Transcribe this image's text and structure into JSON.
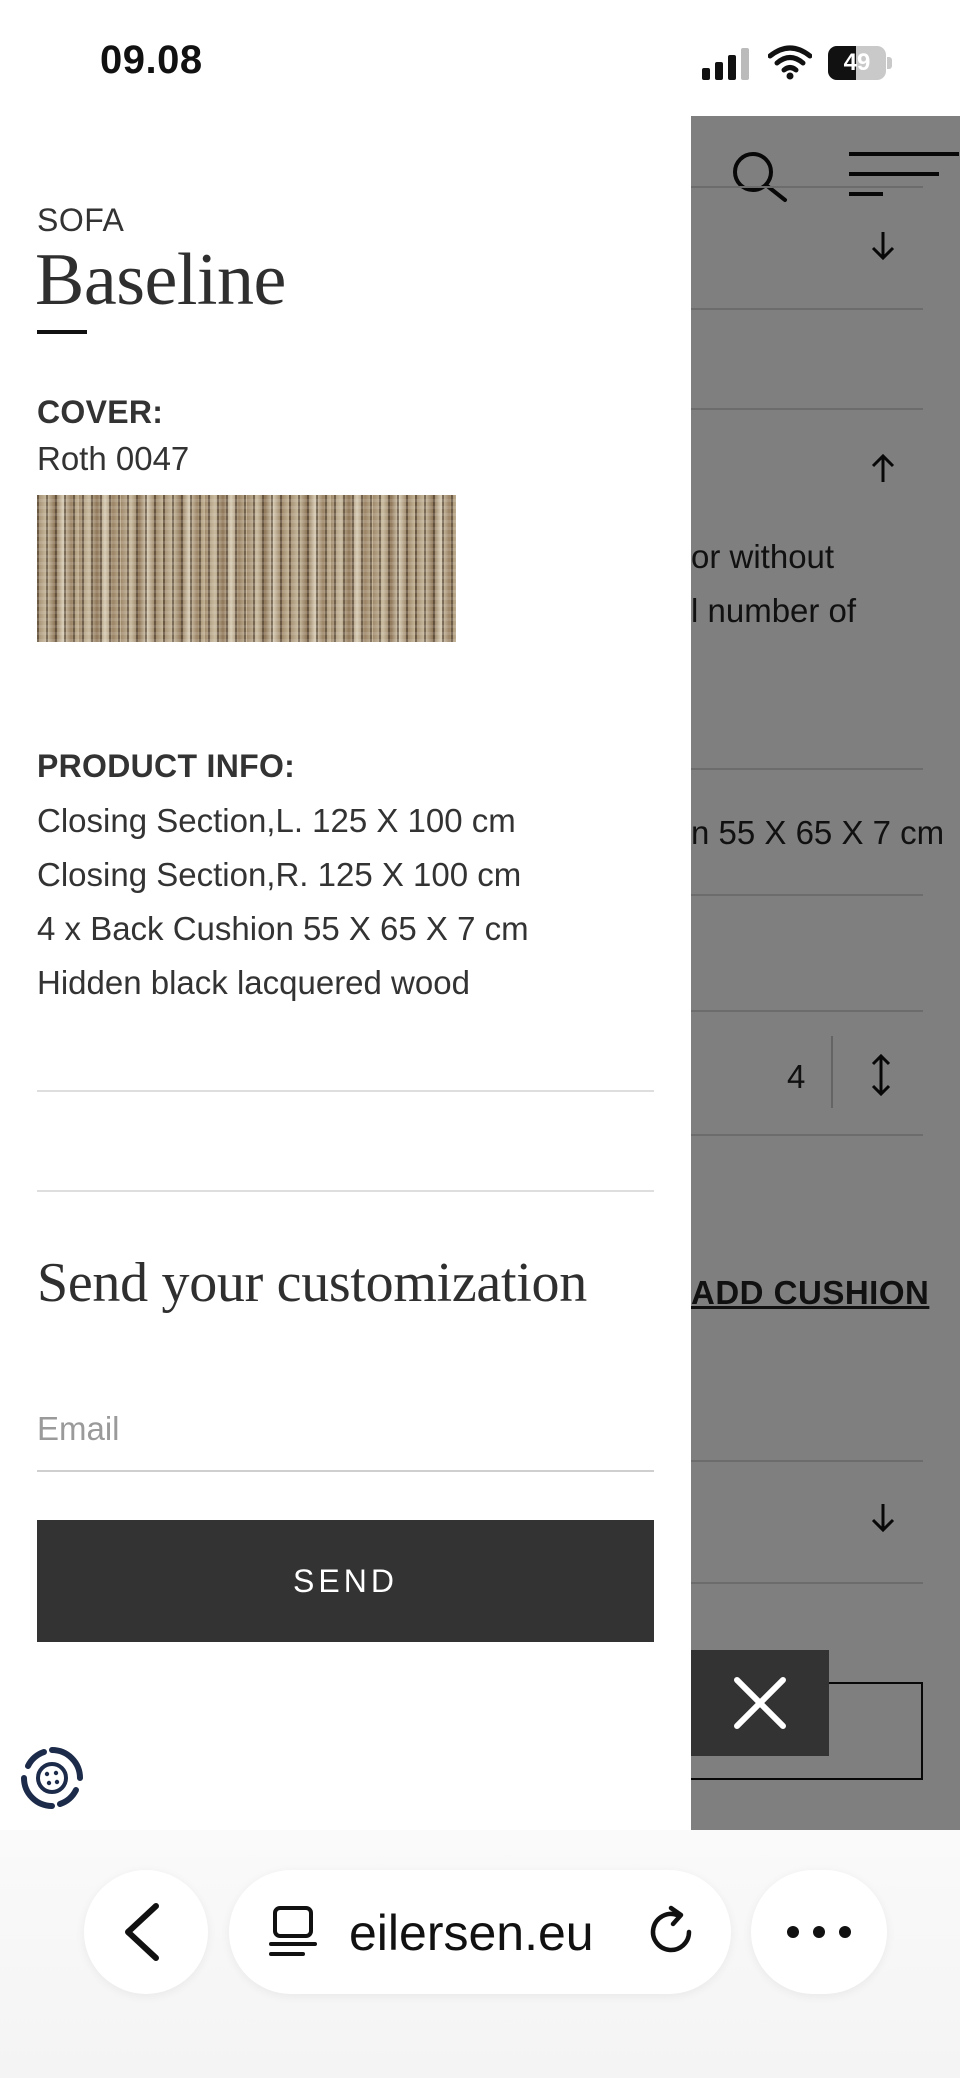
{
  "status_bar": {
    "time": "09.08",
    "battery_level": "49"
  },
  "background_page": {
    "visible_text_fragments": [
      "or without",
      "l number of",
      "n 55 X 65 X 7 cm"
    ],
    "quantity_value": "4",
    "add_cushion_label": "ADD CUSHION"
  },
  "drawer": {
    "category": "SOFA",
    "product_name": "Baseline",
    "cover_label": "COVER:",
    "cover_value": "Roth 0047",
    "product_info_label": "PRODUCT INFO:",
    "product_info_lines": [
      "Closing Section,L. 125 X 100 cm",
      "Closing Section,R. 125 X 100 cm",
      "4 x Back Cushion 55 X 65 X 7 cm",
      "Hidden black lacquered wood"
    ],
    "send_heading": "Send your customization",
    "email_placeholder": "Email",
    "email_value": "",
    "send_label": "SEND"
  },
  "browser": {
    "url": "eilersen.eu"
  },
  "colors": {
    "button_dark": "#333333",
    "overlay": "rgba(0,0,0,0.5)",
    "text": "#333333"
  },
  "icons": [
    "search-icon",
    "menu-icon",
    "chevron-down-icon",
    "chevron-up-icon",
    "sort-icon",
    "close-icon",
    "cookie-settings-icon",
    "back-icon",
    "reader-icon",
    "reload-icon",
    "more-icon"
  ]
}
